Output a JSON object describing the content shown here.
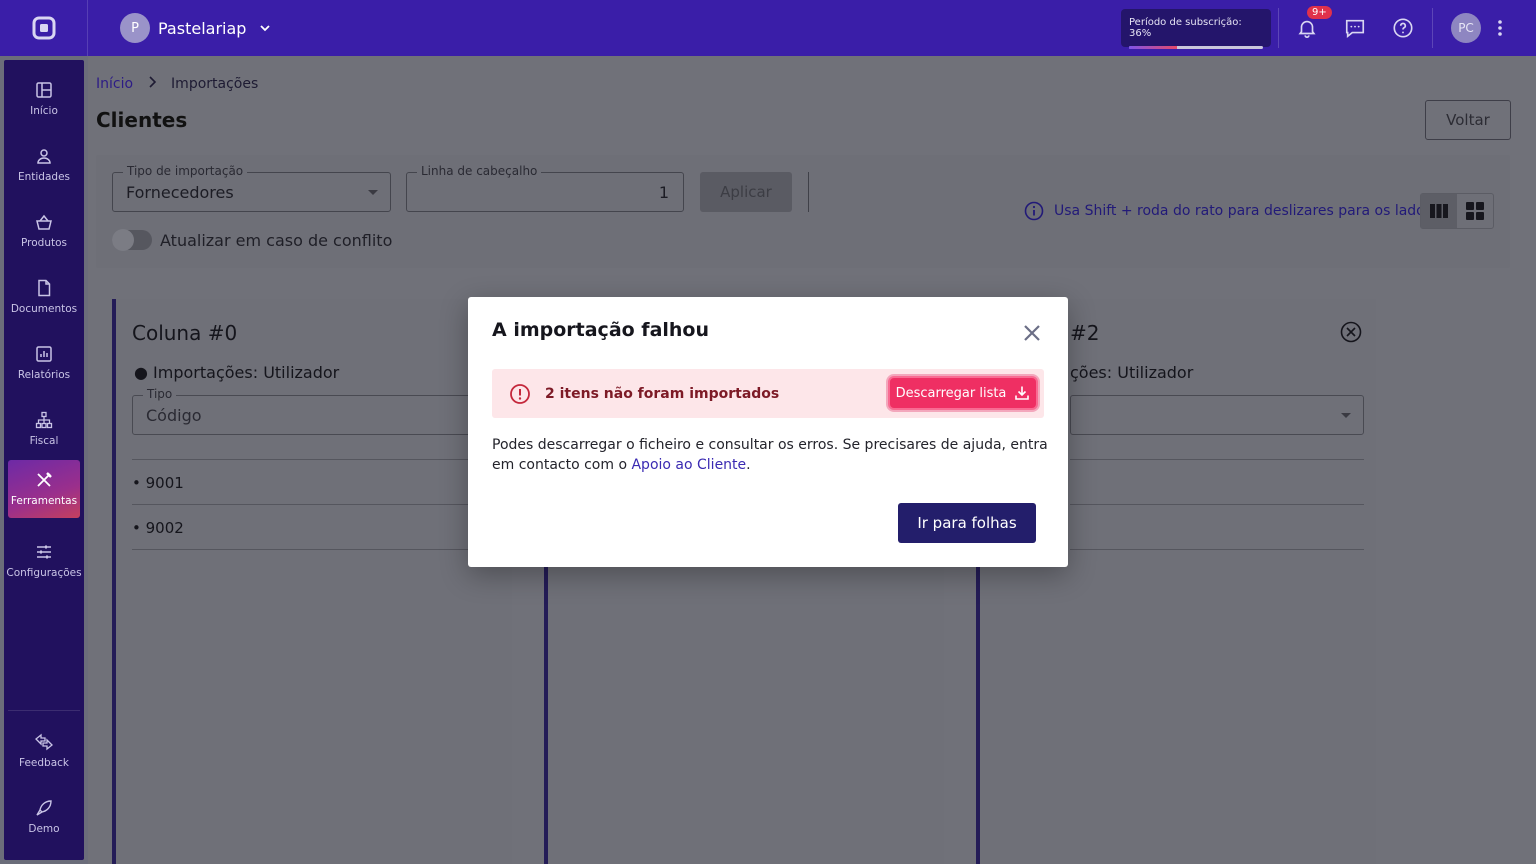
{
  "topbar": {
    "company_initial": "P",
    "company_name": "Pastelariap",
    "subscription_label": "Período de subscrição: 36%",
    "subscription_progress": 0.36,
    "notifications_badge": "9+",
    "user_initials": "PC"
  },
  "sidebar": {
    "items": [
      {
        "label": "Início",
        "icon": "dashboard-icon"
      },
      {
        "label": "Entidades",
        "icon": "person-icon"
      },
      {
        "label": "Produtos",
        "icon": "basket-icon"
      },
      {
        "label": "Documentos",
        "icon": "document-icon"
      },
      {
        "label": "Relatórios",
        "icon": "chart-icon"
      },
      {
        "label": "Fiscal",
        "icon": "network-icon"
      },
      {
        "label": "Ferramentas",
        "icon": "tools-icon",
        "active": true
      },
      {
        "label": "Configurações",
        "icon": "sliders-icon"
      }
    ],
    "bottom_items": [
      {
        "label": "Feedback",
        "icon": "feedback-icon"
      },
      {
        "label": "Demo",
        "icon": "rocket-icon"
      }
    ]
  },
  "breadcrumb": {
    "home": "Início",
    "current": "Importações"
  },
  "page": {
    "title": "Clientes",
    "back_label": "Voltar"
  },
  "filters": {
    "import_type_label": "Tipo de importação",
    "import_type_value": "Fornecedores",
    "header_line_label": "Linha de cabeçalho",
    "header_line_value": "1",
    "apply_label": "Aplicar",
    "conflict_toggle_label": "Atualizar em caso de conflito",
    "hint": "Usa Shift + roda do rato para deslizares para os lados"
  },
  "columns": [
    {
      "title": "Coluna #0",
      "subtitle": "Importações: Utilizador",
      "type_label": "Tipo",
      "type_value": "Código",
      "rows": [
        "• 9001",
        "• 9002"
      ]
    },
    {
      "title": "#2",
      "subtitle": "ções: Utilizador"
    }
  ],
  "modal": {
    "title": "A importação falhou",
    "alert_text": "2 itens não foram importados",
    "download_label": "Descarregar lista",
    "body_text": "Podes descarregar o ficheiro e consultar os erros. Se precisares de ajuda, entra em contacto com o ",
    "body_link": "Apoio ao Cliente",
    "body_end": ".",
    "primary_label": "Ir para folhas"
  },
  "colors": {
    "topbar": "#3a1ea8",
    "sidebar": "#21115e",
    "alert_bg": "#fde6e9",
    "download_button": "#ef2f63",
    "primary_button": "#231e6b"
  }
}
